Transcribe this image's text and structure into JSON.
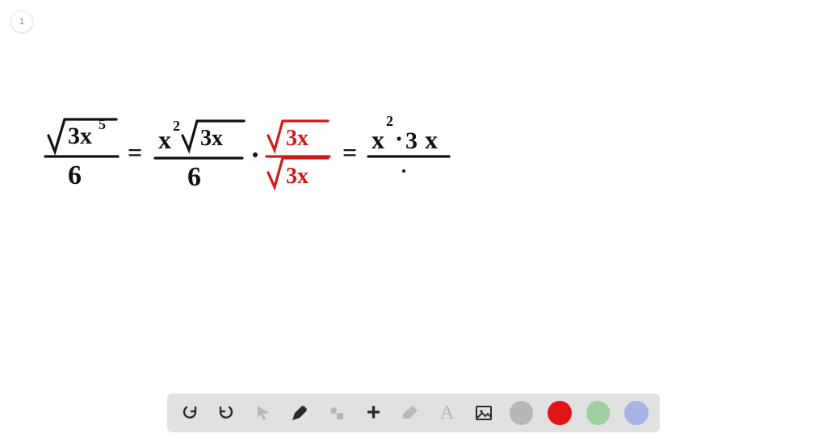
{
  "page_number": "1",
  "handwriting": {
    "color_main": "#111111",
    "color_accent": "#d11a1a",
    "expression_latex": "\\frac{\\sqrt{3x^5}}{6} = \\frac{x^2\\sqrt{3x}}{6} \\cdot \\frac{\\sqrt{3x}}{\\sqrt{3x}} = \\frac{x^2 \\cdot 3x}{\\,}",
    "terms": {
      "t1_num_under_root": "3x",
      "t1_num_exp": "5",
      "t1_den": "6",
      "t2_coef": "x",
      "t2_coef_exp": "2",
      "t2_under_root": "3x",
      "t2_den": "6",
      "t3_num_under_root": "3x",
      "t3_den_under_root": "3x",
      "t4_a": "x",
      "t4_a_exp": "2",
      "t4_b": "3",
      "t4_c": "x",
      "eq": "=",
      "dot": "·"
    }
  },
  "toolbar": {
    "undo": "Undo",
    "redo": "Redo",
    "pointer": "Pointer",
    "pen": "Pen",
    "shapes": "Shapes",
    "add": "Add",
    "eraser": "Eraser",
    "text": "Text",
    "image": "Image",
    "colors": {
      "gray": "#b7b7b7",
      "red": "#e01616",
      "green": "#9fce9f",
      "blue": "#a9b4e6"
    }
  }
}
